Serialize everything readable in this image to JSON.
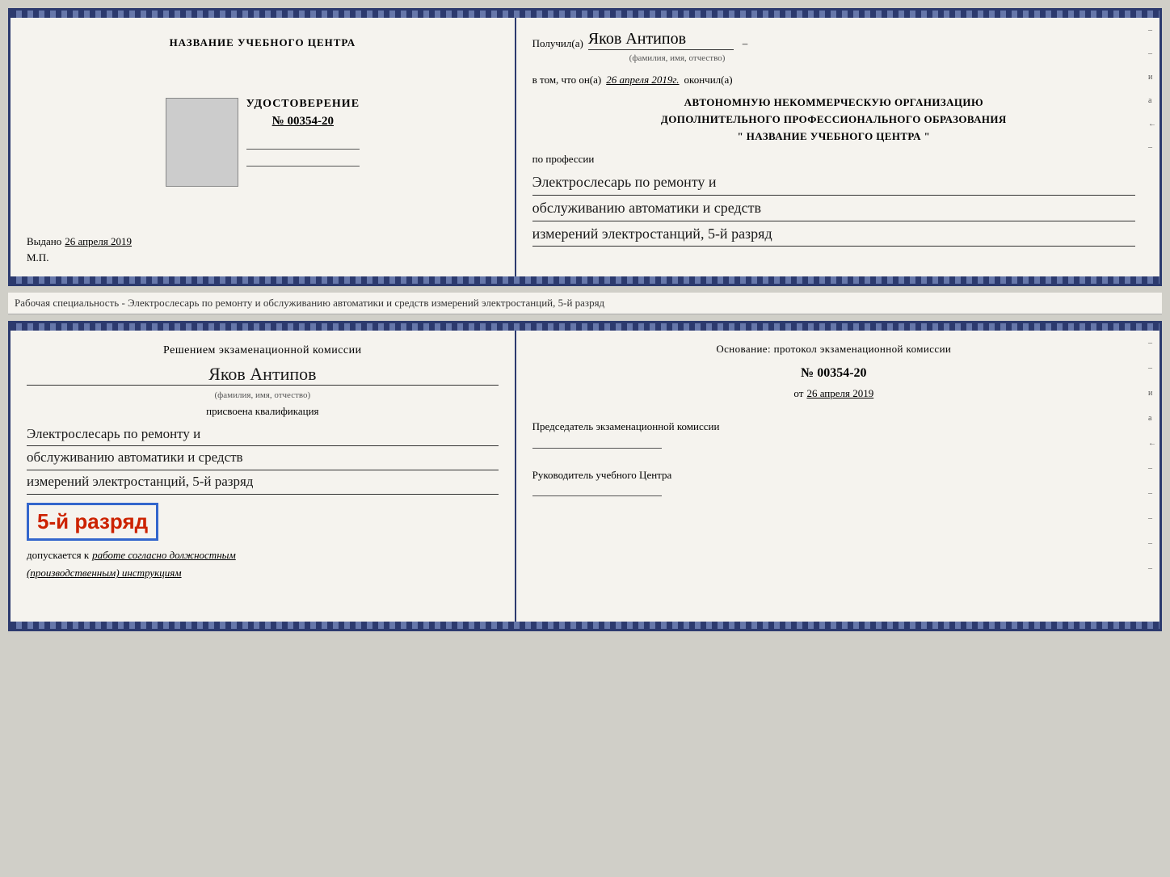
{
  "cert_top": {
    "left": {
      "org_name": "НАЗВАНИЕ УЧЕБНОГО ЦЕНТРА",
      "udost_label": "УДОСТОВЕРЕНИЕ",
      "udost_number": "№ 00354-20",
      "vydano_label": "Выдано",
      "vydano_date": "26 апреля 2019",
      "mp_label": "М.П."
    },
    "right": {
      "poluchil_label": "Получил(а)",
      "recipient_name": "Яков Антипов",
      "fio_subtitle": "(фамилия, имя, отчество)",
      "vtom_label": "в том, что он(а)",
      "date_value": "26 апреля 2019г.",
      "okonchil_label": "окончил(а)",
      "org_text_line1": "АВТОНОМНУЮ НЕКОММЕРЧЕСКУЮ ОРГАНИЗАЦИЮ",
      "org_text_line2": "ДОПОЛНИТЕЛЬНОГО ПРОФЕССИОНАЛЬНОГО ОБРАЗОВАНИЯ",
      "org_text_line3": "\"   НАЗВАНИЕ УЧЕБНОГО ЦЕНТРА   \"",
      "po_professii_label": "по профессии",
      "profession_line1": "Электрослесарь по ремонту и",
      "profession_line2": "обслуживанию автоматики и средств",
      "profession_line3": "измерений электростанций, 5-й разряд"
    }
  },
  "between": {
    "text": "Рабочая специальность - Электрослесарь по ремонту и обслуживанию автоматики и средств измерений электростанций, 5-й разряд"
  },
  "cert_bottom": {
    "left": {
      "resheniem_label": "Решением экзаменационной комиссии",
      "name_value": "Яков Антипов",
      "fio_subtitle": "(фамилия, имя, отчество)",
      "prisvoena_label": "присвоена квалификация",
      "qualification_line1": "Электрослесарь по ремонту и",
      "qualification_line2": "обслуживанию автоматики и средств",
      "qualification_line3": "измерений электростанций, 5-й разряд",
      "razryad_badge": "5-й разряд",
      "dopuskaetsya_label": "допускается к",
      "dopuskaetsya_hw": "работе согласно должностным",
      "dopuskaetsya_hw2": "(производственным) инструкциям"
    },
    "right": {
      "osnovanie_label": "Основание: протокол экзаменационной комиссии",
      "protocol_number": "№  00354-20",
      "ot_label": "от",
      "ot_date": "26 апреля 2019",
      "predsedatel_label": "Председатель экзаменационной комиссии",
      "rukovoditel_label": "Руководитель учебного Центра"
    }
  },
  "side_marks": [
    "–",
    "–",
    "и",
    "а",
    "←",
    "–",
    "–",
    "–",
    "–",
    "–"
  ]
}
